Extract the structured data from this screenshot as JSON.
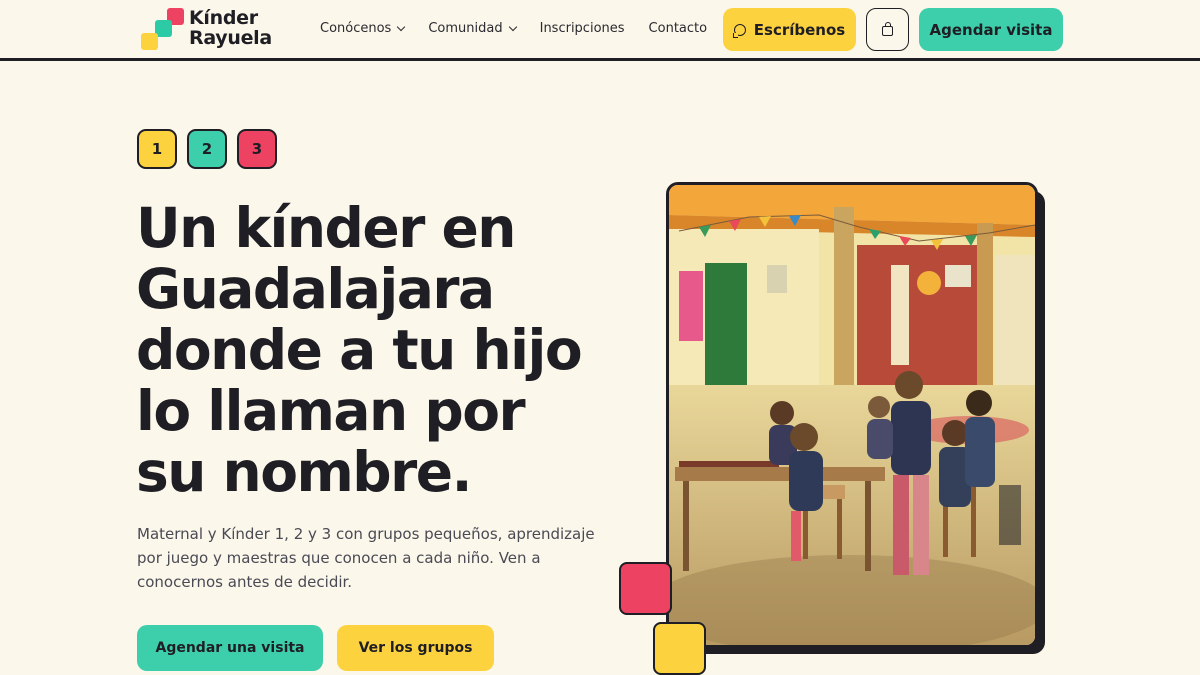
{
  "brand": {
    "logo_line1": "Kínder",
    "logo_line2": "Rayuela"
  },
  "nav": {
    "items": [
      {
        "label": "Conócenos",
        "dropdown": true
      },
      {
        "label": "Comunidad",
        "dropdown": true
      },
      {
        "label": "Inscripciones",
        "dropdown": false
      },
      {
        "label": "Contacto",
        "dropdown": false
      }
    ],
    "write_label": "Escríbenos",
    "cart_icon": "shopping-bag-icon",
    "visit_label": "Agendar visita"
  },
  "hero": {
    "badges": [
      "1",
      "2",
      "3"
    ],
    "headline_lines": [
      "Un kínder en",
      "Guadalajara",
      "donde a tu hijo",
      "lo llaman por",
      "su nombre."
    ],
    "lead": "Maternal y Kínder 1, 2 y 3 con grupos pequeños, aprendizaje por juego y maestras que conocen a cada niño. Ven a conocernos antes de decidir.",
    "primary_cta": "Agendar una visita",
    "secondary_cta": "Ver los grupos"
  },
  "colors": {
    "background": "#fbf7ea",
    "yellow": "#fdd23f",
    "teal": "#3dcfab",
    "red": "#ee4263",
    "ink": "#1e1e24"
  }
}
